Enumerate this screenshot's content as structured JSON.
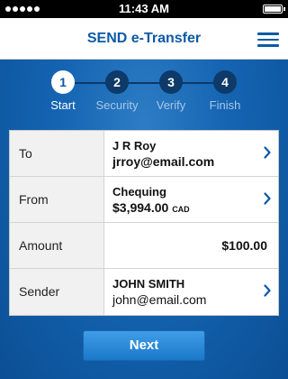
{
  "status_bar": {
    "time": "11:43 AM"
  },
  "header": {
    "title": "SEND e-Transfer",
    "menu_icon": "hamburger-menu-icon"
  },
  "stepper": {
    "steps": [
      {
        "number": "1",
        "label": "Start",
        "active": true
      },
      {
        "number": "2",
        "label": "Security",
        "active": false
      },
      {
        "number": "3",
        "label": "Verify",
        "active": false
      },
      {
        "number": "4",
        "label": "Finish",
        "active": false
      }
    ]
  },
  "form": {
    "to": {
      "label": "To",
      "name": "J R Roy",
      "email": "jrroy@email.com"
    },
    "from": {
      "label": "From",
      "account": "Chequing",
      "balance": "$3,994.00",
      "currency": "CAD"
    },
    "amount": {
      "label": "Amount",
      "value": "$100.00"
    },
    "sender": {
      "label": "Sender",
      "name": "JOHN SMITH",
      "email": "john@email.com"
    }
  },
  "actions": {
    "next_label": "Next"
  },
  "colors": {
    "brand_blue": "#0b5aa6",
    "button_blue": "#2a88d8",
    "step_inactive": "#0d3a68"
  }
}
